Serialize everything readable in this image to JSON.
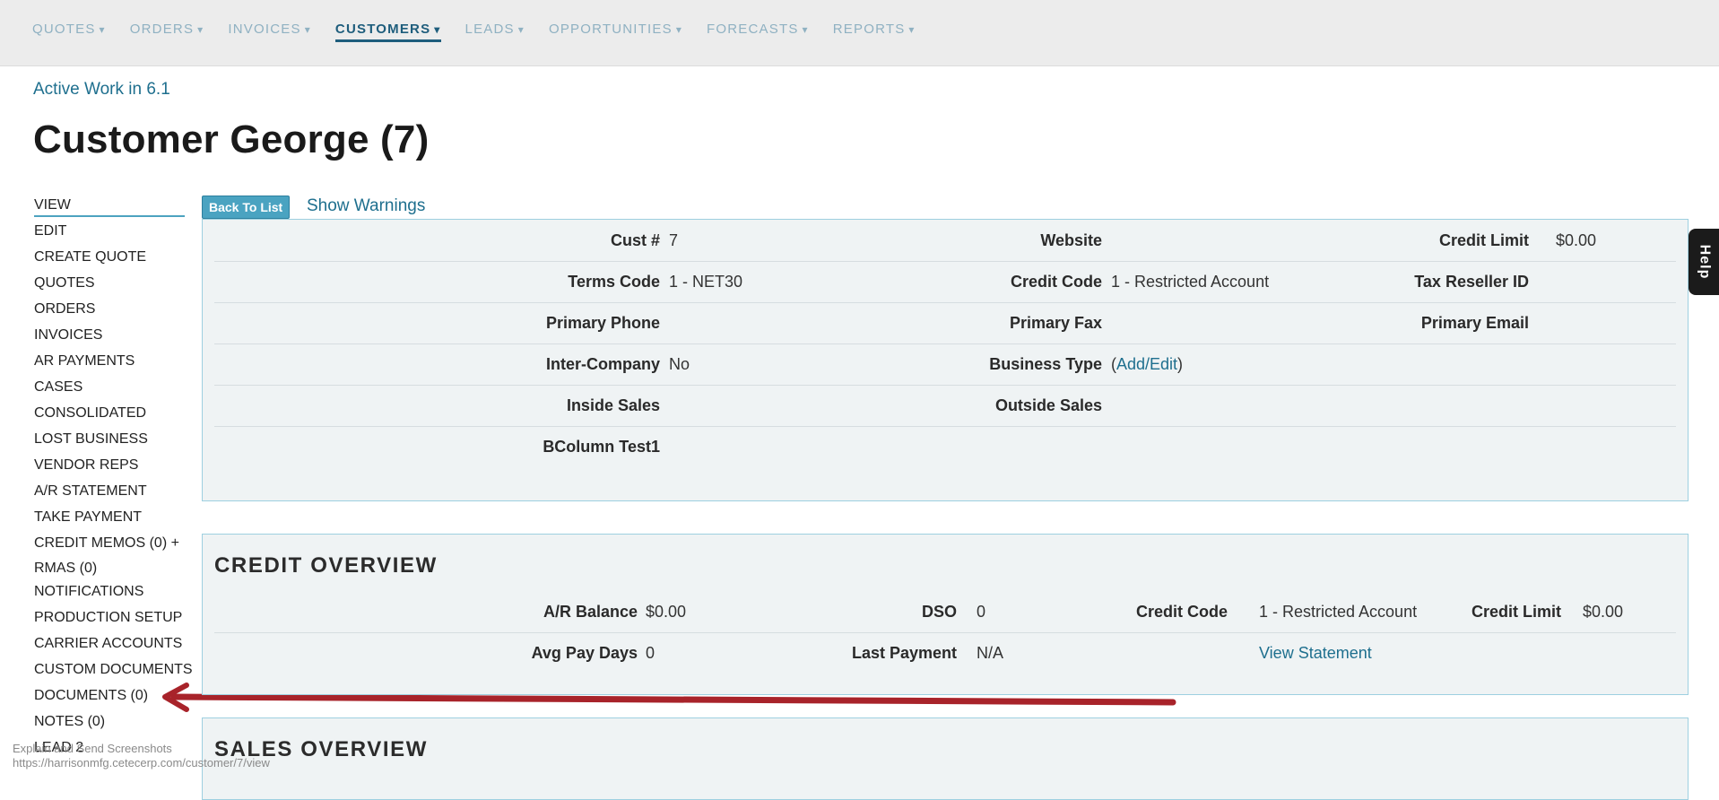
{
  "nav": {
    "items": [
      {
        "label": "QUOTES",
        "caret": "▾",
        "active": false
      },
      {
        "label": "ORDERS",
        "caret": "▾",
        "active": false
      },
      {
        "label": "INVOICES",
        "caret": "▾",
        "active": false
      },
      {
        "label": "CUSTOMERS",
        "caret": "▾",
        "active": true
      },
      {
        "label": "LEADS",
        "caret": "▾",
        "active": false
      },
      {
        "label": "OPPORTUNITIES",
        "caret": "▾",
        "active": false
      },
      {
        "label": "FORECASTS",
        "caret": "▾",
        "active": false
      },
      {
        "label": "REPORTS",
        "caret": "▾",
        "active": false
      }
    ]
  },
  "breadcrumb": "Active Work in 6.1",
  "page_title": "Customer George (7)",
  "sidebar": {
    "items": [
      "VIEW",
      "EDIT",
      "CREATE QUOTE",
      "QUOTES",
      "ORDERS",
      "INVOICES",
      "AR PAYMENTS",
      "CASES",
      "CONSOLIDATED",
      "LOST BUSINESS",
      "VENDOR REPS",
      "A/R STATEMENT",
      "TAKE PAYMENT",
      "CREDIT MEMOS (0) + RMAS (0)",
      "NOTIFICATIONS",
      "PRODUCTION SETUP",
      "CARRIER ACCOUNTS",
      "CUSTOM DOCUMENTS",
      "DOCUMENTS (0)",
      "NOTES (0)",
      "LEAD 2"
    ]
  },
  "actions": {
    "back_label": "Back To List",
    "warnings_label": "Show Warnings"
  },
  "customer": {
    "cust_num_label": "Cust #",
    "cust_num": "7",
    "website_label": "Website",
    "website": "",
    "credit_limit_label": "Credit Limit",
    "credit_limit": "$0.00",
    "terms_label": "Terms Code",
    "terms": "1 - NET30",
    "credit_code_label": "Credit Code",
    "credit_code": "1 - Restricted Account",
    "tax_reseller_label": "Tax Reseller ID",
    "tax_reseller": "",
    "phone_label": "Primary Phone",
    "fax_label": "Primary Fax",
    "email_label": "Primary Email",
    "intercompany_label": "Inter-Company",
    "intercompany": "No",
    "business_type_label": "Business Type",
    "business_type_link": "Add/Edit",
    "inside_sales_label": "Inside Sales",
    "outside_sales_label": "Outside Sales",
    "bcolumn_label": "BColumn Test1"
  },
  "credit": {
    "title": "CREDIT OVERVIEW",
    "ar_balance_label": "A/R Balance",
    "ar_balance": "$0.00",
    "dso_label": "DSO",
    "dso": "0",
    "credit_code_label": "Credit Code",
    "credit_code": "1 - Restricted Account",
    "credit_limit_label": "Credit Limit",
    "credit_limit": "$0.00",
    "avg_pay_label": "Avg Pay Days",
    "avg_pay": "0",
    "last_payment_label": "Last Payment",
    "last_payment": "N/A",
    "view_statement": "View Statement"
  },
  "sales": {
    "title": "SALES OVERVIEW"
  },
  "help_label": "Help",
  "overlay": {
    "line1": "Explain and Send Screenshots",
    "line2": "https://harrisonmfg.cetecerp.com/customer/7/view"
  },
  "colors": {
    "accent": "#1e6f8e",
    "annotation": "#a8232a",
    "panel_bg": "#eff3f4"
  }
}
